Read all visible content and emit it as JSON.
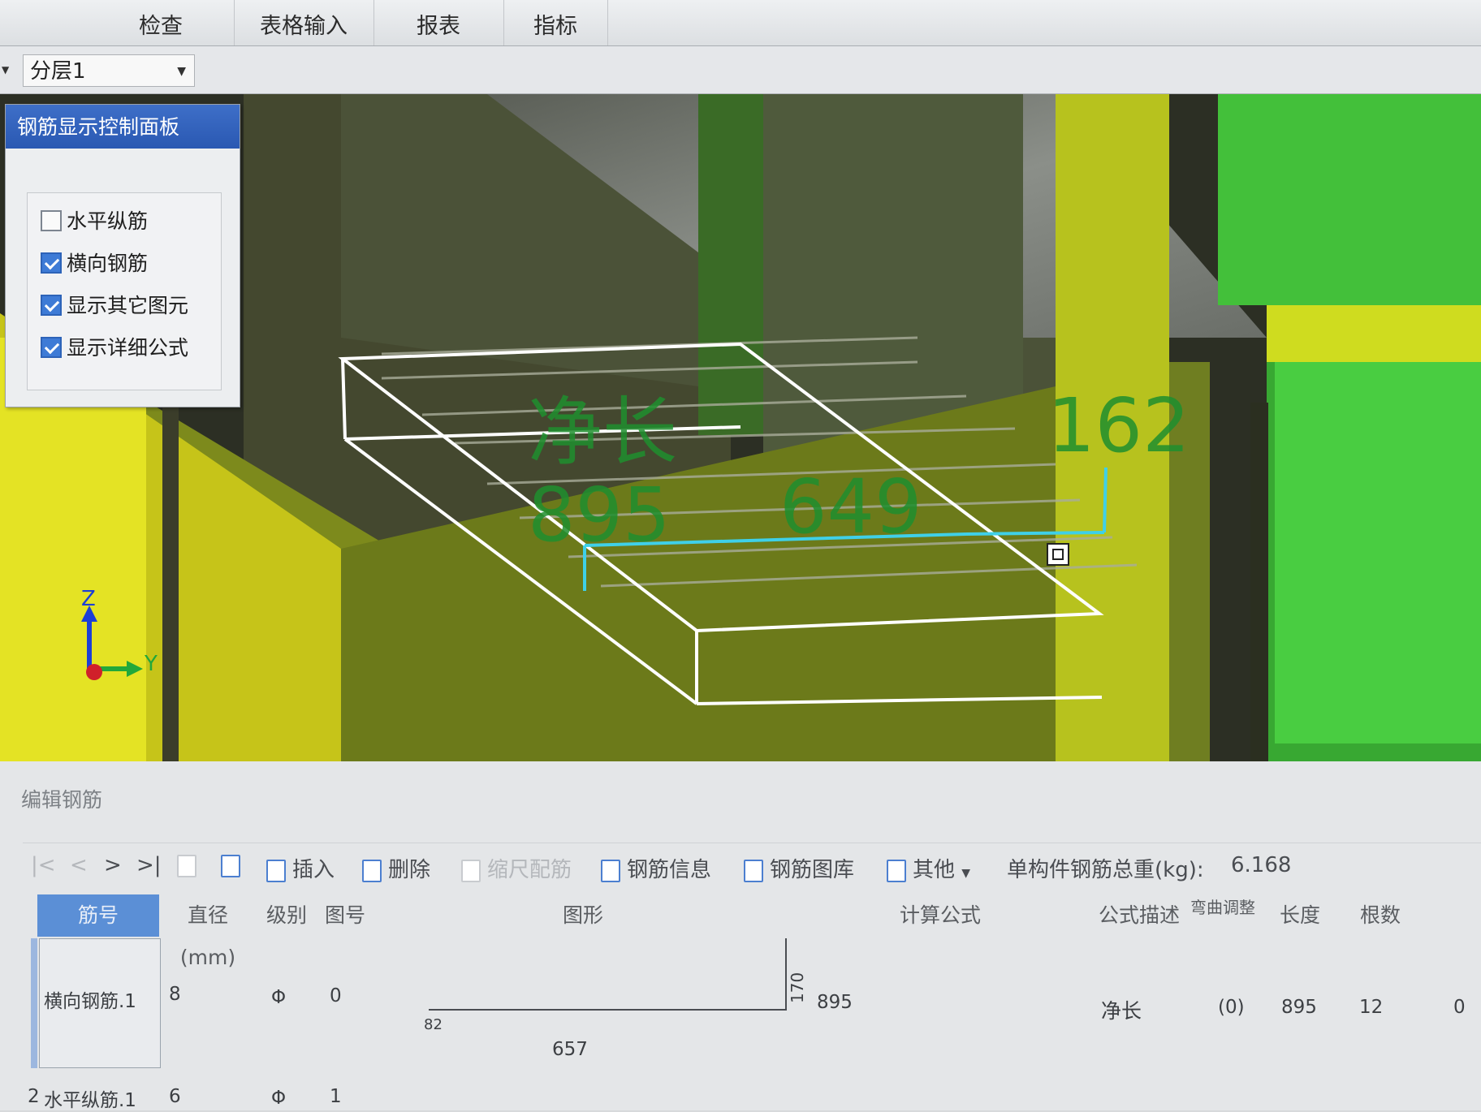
{
  "menu": {
    "tabs": [
      "检查",
      "表格输入",
      "报表",
      "指标"
    ]
  },
  "layer": {
    "selected": "分层1"
  },
  "control_panel": {
    "title": "钢筋显示控制面板",
    "options": [
      {
        "label": "水平纵筋",
        "checked": false
      },
      {
        "label": "横向钢筋",
        "checked": true
      },
      {
        "label": "显示其它图元",
        "checked": true
      },
      {
        "label": "显示详细公式",
        "checked": true
      }
    ]
  },
  "viewport": {
    "annotations": {
      "net_length_label": "净长",
      "value_895": "895",
      "value_649": "649",
      "value_162": "162"
    },
    "axes": {
      "z": "Z",
      "y": "Y"
    },
    "colors": {
      "wireframe": "#ffffff",
      "dimension_text": "#1f8f2e",
      "highlight_bar": "#3fd0e8"
    }
  },
  "editor": {
    "title": "编辑钢筋",
    "toolbar": {
      "nav_first": "|<",
      "nav_prev": "<",
      "nav_next": ">",
      "nav_last": ">|",
      "insert": "插入",
      "delete": "删除",
      "scale_rebar": "缩尺配筋",
      "rebar_info": "钢筋信息",
      "rebar_library": "钢筋图库",
      "other": "其他",
      "total_weight_label": "单构件钢筋总重(kg):",
      "total_weight_value": "6.168"
    },
    "columns": {
      "bar_no": "筋号",
      "diameter": "直径(mm)",
      "grade": "级别",
      "figure_no": "图号",
      "shape": "图形",
      "formula": "计算公式",
      "formula_desc": "公式描述",
      "bend_adjust": "弯曲调整",
      "length": "长度",
      "count": "根数"
    },
    "rows": [
      {
        "bar_no": "横向钢筋.1",
        "diameter": "8",
        "grade": "Φ",
        "figure_no": "0",
        "shape_dim_horizontal": "657",
        "shape_dim_vertical": "170",
        "shape_dim_left": "82",
        "formula": "895",
        "formula_desc": "净长",
        "bend_adjust": "(0)",
        "length": "895",
        "count": "12",
        "extra": "0"
      },
      {
        "index": "2",
        "bar_no": "水平纵筋.1",
        "diameter": "6",
        "grade": "Φ",
        "figure_no": "1"
      }
    ]
  }
}
